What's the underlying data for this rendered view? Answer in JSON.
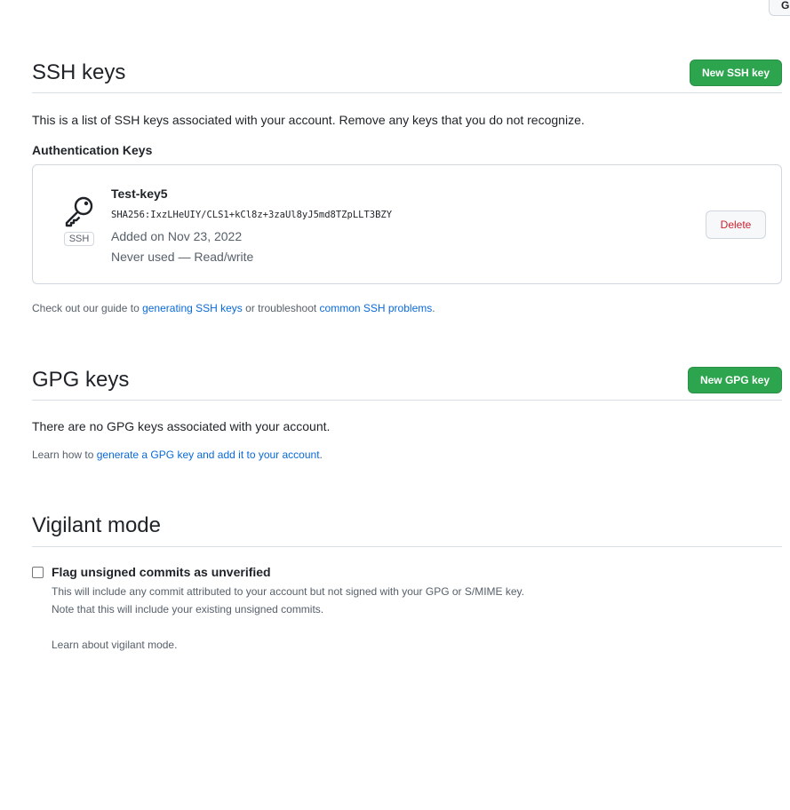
{
  "partial_button": {
    "label": "G"
  },
  "ssh": {
    "title": "SSH keys",
    "new_button": "New SSH key",
    "description": "This is a list of SSH keys associated with your account. Remove any keys that you do not recognize.",
    "subheading": "Authentication Keys",
    "keys": [
      {
        "name": "Test-key5",
        "type_badge": "SSH",
        "fingerprint": "SHA256:IxzLHeUIY/CLS1+kCl8z+3zaUl8yJ5md8TZpLLT3BZY",
        "added": "Added on Nov 23, 2022",
        "usage": "Never used — Read/write",
        "delete_label": "Delete"
      }
    ],
    "guide_prefix": "Check out our guide to ",
    "guide_link1": "generating SSH keys",
    "guide_middle": " or troubleshoot ",
    "guide_link2": "common SSH problems",
    "guide_suffix": "."
  },
  "gpg": {
    "title": "GPG keys",
    "new_button": "New GPG key",
    "empty_text": "There are no GPG keys associated with your account.",
    "learn_prefix": "Learn how to ",
    "learn_link": "generate a GPG key and add it to your account",
    "learn_suffix": "."
  },
  "vigilant": {
    "title": "Vigilant mode",
    "checkbox_label": "Flag unsigned commits as unverified",
    "checked": false,
    "note_line1": "This will include any commit attributed to your account but not signed with your GPG or S/MIME key.",
    "note_line2": "Note that this will include your existing unsigned commits.",
    "learn_link": "Learn about vigilant mode."
  },
  "colors": {
    "primary_button": "#2da44e",
    "link": "#0969da",
    "danger": "#cf222e"
  },
  "icons": {
    "key": "key-icon"
  }
}
